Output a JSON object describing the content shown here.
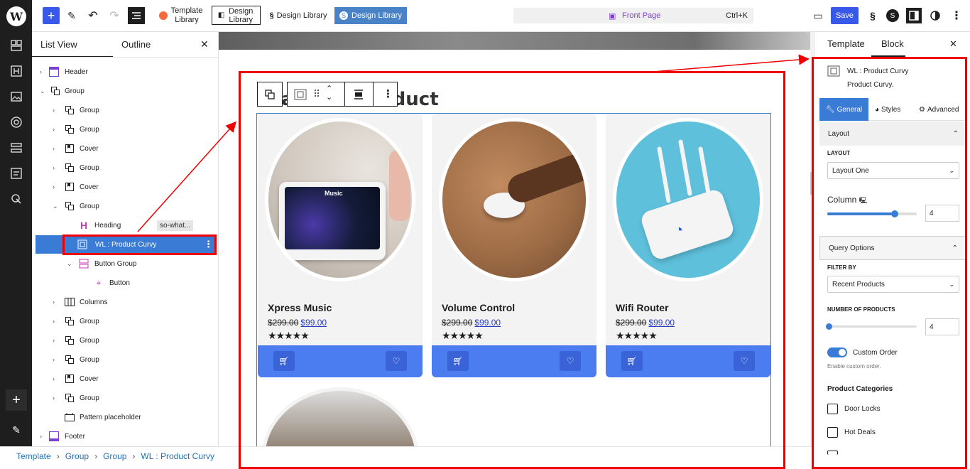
{
  "topbar": {
    "template_library": "Template Library",
    "design_library_1": "Design Library",
    "design_library_2": "Design Library",
    "design_library_3": "Design Library",
    "front_page": "Front Page",
    "shortcut": "Ctrl+K",
    "save": "Save"
  },
  "listview": {
    "tab_list": "List View",
    "tab_outline": "Outline",
    "items": [
      {
        "label": "Header"
      },
      {
        "label": "Group"
      },
      {
        "label": "Group"
      },
      {
        "label": "Group"
      },
      {
        "label": "Cover"
      },
      {
        "label": "Group"
      },
      {
        "label": "Cover"
      },
      {
        "label": "Group"
      },
      {
        "label": "Heading",
        "badge": "so-what..."
      },
      {
        "label": "WL : Product Curvy"
      },
      {
        "label": "Button Group"
      },
      {
        "label": "Button"
      },
      {
        "label": "Columns"
      },
      {
        "label": "Group"
      },
      {
        "label": "Group"
      },
      {
        "label": "Group"
      },
      {
        "label": "Cover"
      },
      {
        "label": "Group"
      },
      {
        "label": "Pattern placeholder"
      },
      {
        "label": "Footer"
      }
    ]
  },
  "breadcrumb": [
    "Template",
    "Group",
    "Group",
    "WL : Product Curvy"
  ],
  "canvas": {
    "heading": "Featured Product",
    "products": [
      {
        "name": "Xpress Music",
        "old_price": "$299.00",
        "price": "$99.00",
        "stars": "★★★★★"
      },
      {
        "name": "Volume Control",
        "old_price": "$299.00",
        "price": "$99.00",
        "stars": "★★★★★"
      },
      {
        "name": "Wifi Router",
        "old_price": "$299.00",
        "price": "$99.00",
        "stars": "★★★★★"
      }
    ],
    "music_screen": "Music"
  },
  "rightpanel": {
    "tab_template": "Template",
    "tab_block": "Block",
    "block_name": "WL : Product Curvy",
    "block_desc": "Product Curvy.",
    "tab_general": "General",
    "tab_styles": "Styles",
    "tab_advanced": "Advanced",
    "layout_section": "Layout",
    "layout_label": "LAYOUT",
    "layout_value": "Layout One",
    "column_label": "Column",
    "column_value": "4",
    "column_fraction": 0.75,
    "query_section": "Query Options",
    "filter_label": "FILTER BY",
    "filter_value": "Recent Products",
    "num_label": "NUMBER OF PRODUCTS",
    "num_value": "4",
    "num_fraction": 0.0,
    "custom_order": "Custom Order",
    "custom_order_help": "Enable custom order.",
    "categories_label": "Product Categories",
    "categories": [
      "Door Locks",
      "Hot Deals"
    ]
  },
  "colors": {
    "accent": "#3858e9",
    "card_bar": "#4c7df0",
    "selection": "#3a7bd5",
    "annotation": "#e00000"
  }
}
